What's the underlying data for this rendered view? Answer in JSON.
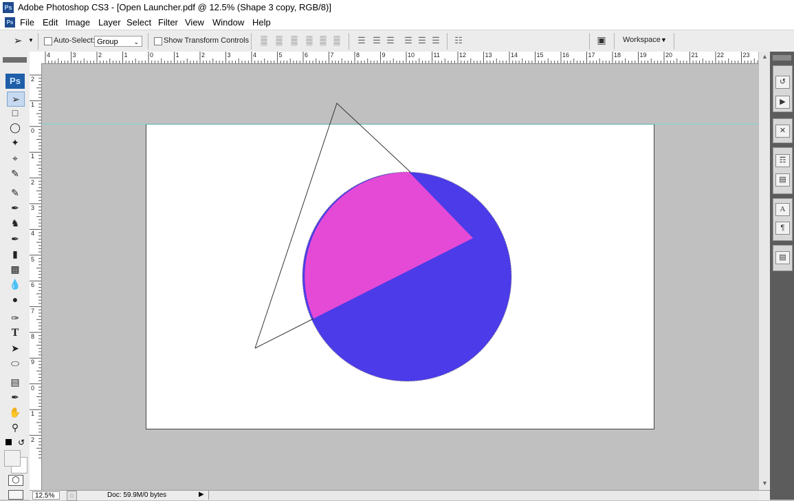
{
  "window": {
    "title": "Adobe Photoshop CS3 - [Open Launcher.pdf @ 12.5% (Shape 3 copy, RGB/8)]",
    "app_icon": "Ps"
  },
  "menu": [
    "File",
    "Edit",
    "Image",
    "Layer",
    "Select",
    "Filter",
    "View",
    "Window",
    "Help"
  ],
  "options": {
    "auto_select_label": "Auto-Select:",
    "auto_select_checked": false,
    "auto_select_value": "Group",
    "show_transform_label": "Show Transform Controls",
    "show_transform_checked": false,
    "workspace_label": "Workspace"
  },
  "ruler": {
    "top_labels": [
      "4",
      "3",
      "2",
      "1",
      "0",
      "1",
      "2",
      "3",
      "4",
      "5",
      "6",
      "7",
      "8",
      "9",
      "10",
      "11",
      "12",
      "13",
      "14",
      "15",
      "16",
      "17",
      "18",
      "19",
      "20",
      "21",
      "22",
      "23"
    ],
    "left_labels": [
      "2",
      "1",
      "0",
      "1",
      "2",
      "3",
      "4",
      "5",
      "6",
      "7",
      "8",
      "9",
      "0",
      "1",
      "2"
    ]
  },
  "toolbox": {
    "logo": "Ps"
  },
  "status": {
    "zoom": "12.5%",
    "doc_info": "Doc: 59.9M/0 bytes"
  },
  "colors": {
    "circle_blue": "#4b3be8",
    "slice_magenta": "#e44ad6",
    "canvas_bg": "#c0c0c0",
    "doc_bg": "#ffffff",
    "guide": "#5fe0e0"
  }
}
